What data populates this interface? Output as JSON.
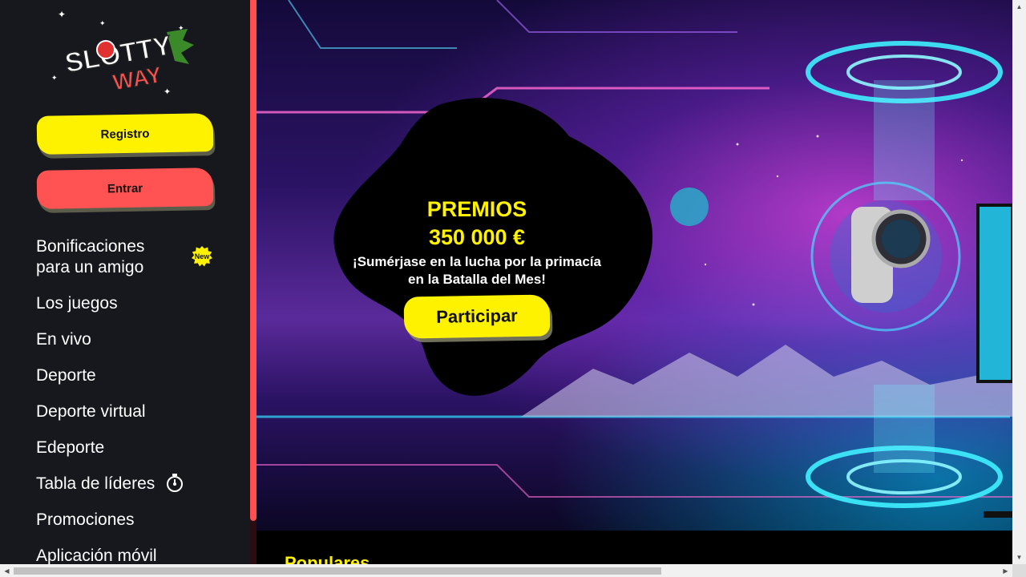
{
  "brand": {
    "logo_line1": "SLOTTY",
    "logo_line2": "WAY"
  },
  "auth": {
    "register_label": "Registro",
    "login_label": "Entrar"
  },
  "sidebar": {
    "items": [
      {
        "label_line1": "Bonificaciones",
        "label_line2": "para un amigo",
        "badge": "New"
      },
      {
        "label": "Los juegos"
      },
      {
        "label": "En vivo"
      },
      {
        "label": "Deporte"
      },
      {
        "label": "Deporte virtual"
      },
      {
        "label": "Edeporte"
      },
      {
        "label": "Tabla de líderes",
        "icon": "stopwatch-icon"
      },
      {
        "label": "Promociones"
      },
      {
        "label": "Aplicación móvil"
      }
    ]
  },
  "banner": {
    "title": "PREMIOS",
    "amount": "350 000 €",
    "desc_line1": "¡Sumérjase en la lucha por la primacía",
    "desc_line2": "en la Batalla del Mes!",
    "cta_label": "Participar"
  },
  "sections": {
    "popular_title": "Populares"
  },
  "colors": {
    "accent_yellow": "#fff200",
    "accent_red": "#ff5252",
    "sidebar_bg": "#17181d"
  }
}
